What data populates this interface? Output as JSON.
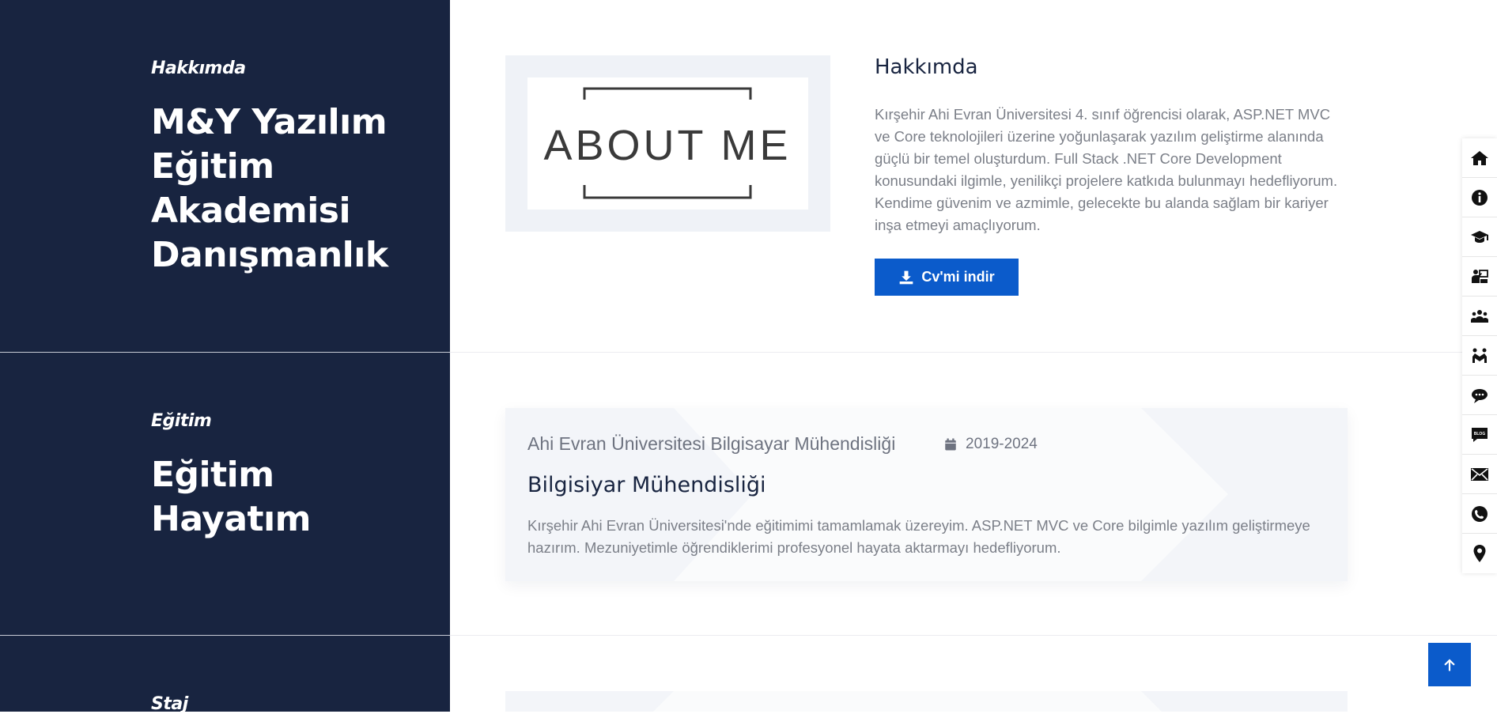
{
  "about": {
    "kicker": "Hakkımda",
    "title_lines": [
      "M&Y Yazılım",
      "Eğitim",
      "Akademisi",
      "Danışmanlık"
    ],
    "image_text": "ABOUT ME",
    "heading": "Hakkımda",
    "text": "Kırşehir Ahi Evran Üniversitesi 4. sınıf öğrencisi olarak, ASP.NET MVC ve Core teknolojileri üzerine yoğunlaşarak yazılım geliştirme alanında güçlü bir temel oluşturdum. Full Stack .NET Core Development konusundaki ilgimle, yenilikçi projelere katkıda bulunmayı hedefliyorum. Kendime güvenim ve azmimle, gelecekte bu alanda sağlam bir kariyer inşa etmeyi amaçlıyorum.",
    "cv_button": "Cv'mi indir"
  },
  "education": {
    "kicker": "Eğitim",
    "title_lines": [
      "Eğitim",
      "Hayatım"
    ],
    "school": "Ahi Evran Üniversitesi Bilgisayar Mühendisliği",
    "date": "2019-2024",
    "degree": "Bilgisiyar Mühendisliği",
    "description": "Kırşehir Ahi Evran Üniversitesi'nde eğitimimi tamamlamak üzereyim. ASP.NET MVC ve Core bilgimle yazılım geliştirmeye hazırım. Mezuniyetimle öğrendiklerimi profesyonel hayata aktarmayı hedefliyorum."
  },
  "internship": {
    "kicker": "Staj"
  },
  "side_nav": [
    {
      "icon": "home-icon"
    },
    {
      "icon": "info-icon"
    },
    {
      "icon": "graduation-cap-icon"
    },
    {
      "icon": "teacher-icon"
    },
    {
      "icon": "users-icon"
    },
    {
      "icon": "handshake-icon"
    },
    {
      "icon": "chat-icon"
    },
    {
      "icon": "blog-icon",
      "label": "BLOG"
    },
    {
      "icon": "mail-icon"
    },
    {
      "icon": "phone-icon"
    },
    {
      "icon": "location-icon"
    }
  ],
  "colors": {
    "navy": "#182440",
    "accent": "#0b5bcb",
    "card_bg": "#f3f5f9",
    "muted_text": "#7b7f88"
  }
}
